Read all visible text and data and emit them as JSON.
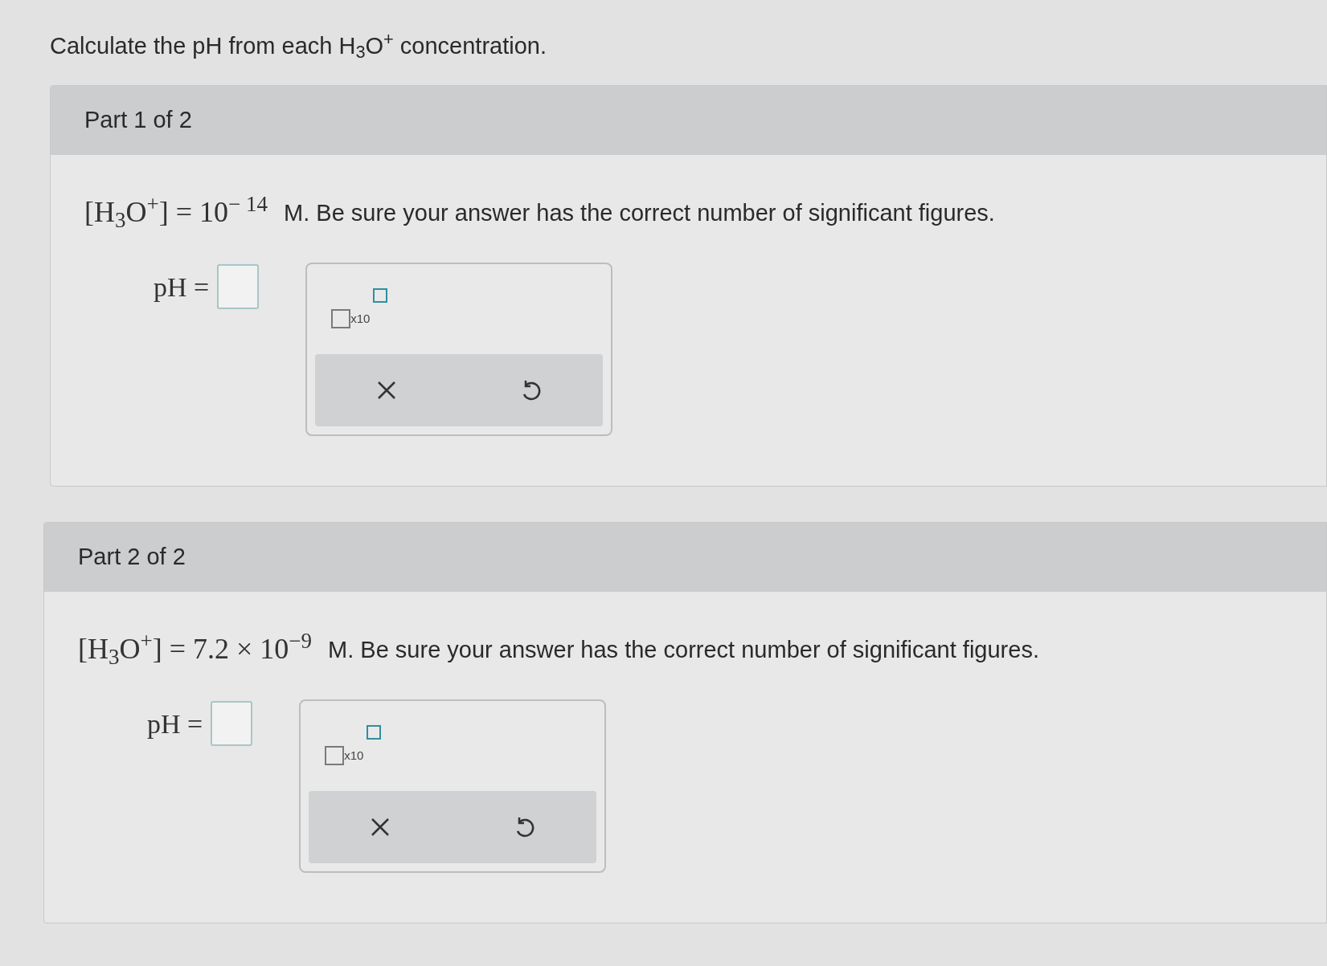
{
  "question": "Calculate the pH from each H$_{3}$O$^{+}$ concentration.",
  "parts": [
    {
      "title": "Part 1 of 2",
      "concentration": "[H$_{3}$O$^{+}$] = 10$^{− 14}$",
      "instruction": "M. Be sure your answer has the correct number of significant figures.",
      "answer_label": "pH =",
      "sci_label": "x10"
    },
    {
      "title": "Part 2 of 2",
      "concentration": "[H$_{3}$O$^{+}$] = 7.2 × 10$^{−9}$",
      "instruction": "M. Be sure your answer has the correct number of significant figures.",
      "answer_label": "pH =",
      "sci_label": "x10"
    }
  ]
}
